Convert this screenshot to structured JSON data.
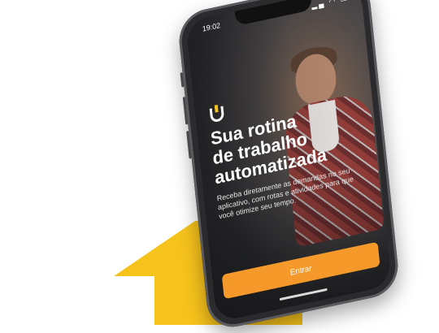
{
  "colors": {
    "arrow": "#f6c21c",
    "button": "#f59a2a",
    "logo_accent": "#f6c21c"
  },
  "status_bar": {
    "time": "19:02",
    "icons": "▂▄ ◠ ▭"
  },
  "hero": {
    "headline": "Sua rotina\nde trabalho\nautomatizada",
    "subtext": "Receba diretamente as demandas no seu aplicativo, com rotas e atividades para que você otimize seu tempo."
  },
  "button": {
    "label": "Entrar"
  },
  "icons": {
    "logo": "u-logo-icon",
    "camera": "front-camera-icon"
  }
}
